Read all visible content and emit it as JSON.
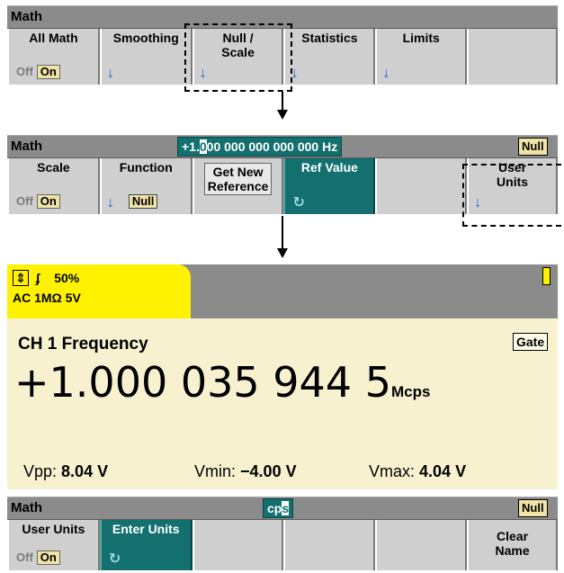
{
  "menu1": {
    "title": "Math",
    "keys": [
      {
        "label1": "All Math",
        "label2": "",
        "off": "Off",
        "on": "On"
      },
      {
        "label1": "Smoothing",
        "label2": ""
      },
      {
        "label1": "Null /",
        "label2": "Scale"
      },
      {
        "label1": "Statistics",
        "label2": ""
      },
      {
        "label1": "Limits",
        "label2": ""
      }
    ]
  },
  "menu2": {
    "title": "Math",
    "entry_prefix": "+1.",
    "entry_cursor": "0",
    "entry_rest": "00 000 000 000 000 Hz",
    "badge": "Null",
    "keys": [
      {
        "label1": "Scale",
        "off": "Off",
        "on": "On"
      },
      {
        "label1": "Function",
        "value": "Null"
      },
      {
        "label1": "Get New",
        "label2": "Reference"
      },
      {
        "label1": "Ref Value"
      },
      {
        "label1": "User",
        "label2": "Units"
      }
    ]
  },
  "display": {
    "trigger_symbol": "⇕",
    "slope_symbol": "ʄ",
    "trigger_level": "50%",
    "coupling": "AC 1MΩ  5V",
    "channel_label": "CH 1 Frequency",
    "gate_badge": "Gate",
    "reading": "+1.000 035 944 5",
    "reading_unit": "Mcps",
    "vpp_label": "Vpp:",
    "vpp_value": "8.04 V",
    "vmin_label": "Vmin:",
    "vmin_value": "−4.00 V",
    "vmax_label": "Vmax:",
    "vmax_value": "4.04 V"
  },
  "menu3": {
    "title": "Math",
    "entry_text": "cp",
    "entry_cursor": "s",
    "badge": "Null",
    "keys": [
      {
        "label1": "User Units",
        "off": "Off",
        "on": "On"
      },
      {
        "label1": "Enter Units"
      },
      {
        "label1": "Clear",
        "label2": "Name"
      }
    ]
  },
  "colors": {
    "title_gray": "#8b8b8b",
    "key_gray": "#cfcfcf",
    "teal": "#13706f",
    "yellow": "#fff200",
    "panel": "#f8f1d0",
    "arrow_blue": "#1f5fd6"
  }
}
